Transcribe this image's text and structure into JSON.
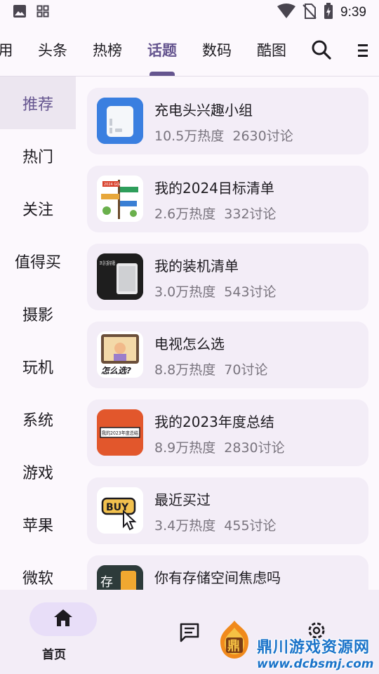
{
  "status_bar": {
    "time": "9:39",
    "icons": [
      "image-icon",
      "app-grid-icon",
      "wifi-icon",
      "no-sim-icon",
      "battery-charging-icon"
    ]
  },
  "top_tabs": [
    {
      "label": "用",
      "active": false
    },
    {
      "label": "头条",
      "active": false
    },
    {
      "label": "热榜",
      "active": false
    },
    {
      "label": "话题",
      "active": true
    },
    {
      "label": "数码",
      "active": false
    },
    {
      "label": "酷图",
      "active": false
    }
  ],
  "sidebar": [
    {
      "label": "推荐",
      "active": true
    },
    {
      "label": "热门",
      "active": false
    },
    {
      "label": "关注",
      "active": false
    },
    {
      "label": "值得买",
      "active": false
    },
    {
      "label": "摄影",
      "active": false
    },
    {
      "label": "玩机",
      "active": false
    },
    {
      "label": "系统",
      "active": false
    },
    {
      "label": "游戏",
      "active": false
    },
    {
      "label": "苹果",
      "active": false
    },
    {
      "label": "微软",
      "active": false
    }
  ],
  "topics": [
    {
      "title": "充电头兴趣小组",
      "heat": "10.5万热度",
      "discuss": "2630讨论"
    },
    {
      "title": "我的2024目标清单",
      "heat": "2.6万热度",
      "discuss": "332讨论"
    },
    {
      "title": "我的装机清单",
      "heat": "3.0万热度",
      "discuss": "543讨论"
    },
    {
      "title": "电视怎么选",
      "heat": "8.8万热度",
      "discuss": "70讨论"
    },
    {
      "title": "我的2023年度总结",
      "heat": "8.9万热度",
      "discuss": "2830讨论"
    },
    {
      "title": "最近买过",
      "heat": "3.4万热度",
      "discuss": "455讨论"
    },
    {
      "title": "你有存储空间焦虑吗",
      "heat": "",
      "discuss": ""
    }
  ],
  "thumbs": {
    "t2_text": "2024 GOALS",
    "t3_text": "CPU 显卡 主板 内存 硬盘",
    "t4_text": "怎么选?",
    "t5_text": "我的2023年度总结",
    "t6_text": "BUY",
    "t7_text": "存"
  },
  "bottom_nav": {
    "home_label": "首页",
    "items": [
      "home-icon",
      "message-icon",
      "settings-icon"
    ]
  },
  "watermark": {
    "logo_char": "鼎",
    "text": "鼎川游戏资源网",
    "url": "www.dcbsmj.com"
  },
  "colors": {
    "accent": "#65558f",
    "card_bg": "#f3edf7",
    "active_side_bg": "#ece6f0",
    "meta_text": "#79747e",
    "home_pill": "#e8def8"
  }
}
